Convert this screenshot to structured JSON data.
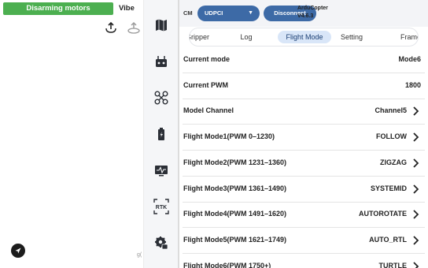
{
  "left_panel": {
    "status_text": "Disarming motors",
    "vibe_label": "Vibe",
    "edge_text": "g("
  },
  "topbar": {
    "cm_label": "CM",
    "connection_type": "UDPCI",
    "disconnect_label": "Disconnect",
    "firmware_name": "ArduCopter",
    "firmware_version": "V4.6.3"
  },
  "tabs": [
    {
      "label": "Gripper",
      "active": false
    },
    {
      "label": "Log",
      "active": false
    },
    {
      "label": "Flight Mode",
      "active": true
    },
    {
      "label": "Setting",
      "active": false
    },
    {
      "label": "Frame",
      "active": false
    }
  ],
  "rows": [
    {
      "label": "Current mode",
      "value": "Mode6",
      "chevron": false
    },
    {
      "label": "Current PWM",
      "value": "1800",
      "chevron": false
    },
    {
      "label": "Model Channel",
      "value": "Channel5",
      "chevron": true
    },
    {
      "label": "Flight Mode1(PWM 0–1230)",
      "value": "FOLLOW",
      "chevron": true
    },
    {
      "label": "Flight Mode2(PWM 1231–1360)",
      "value": "ZIGZAG",
      "chevron": true
    },
    {
      "label": "Flight Mode3(PWM 1361–1490)",
      "value": "SYSTEMID",
      "chevron": true
    },
    {
      "label": "Flight Mode4(PWM 1491–1620)",
      "value": "AUTOROTATE",
      "chevron": true
    },
    {
      "label": "Flight Mode5(PWM 1621–1749)",
      "value": "AUTO_RTL",
      "chevron": true
    },
    {
      "label": "Flight Mode6(PWM 1750+)",
      "value": "TURTLE",
      "chevron": true
    }
  ],
  "rail_icons": [
    "map-icon",
    "remote-controller-icon",
    "drone-icon",
    "battery-icon",
    "telemetry-icon",
    "rtk-icon",
    "settings-icon"
  ],
  "rail_rtk_text": "RTK",
  "colors": {
    "status_green": "#4caf50",
    "button_blue": "#3d6aa6",
    "tab_active_bg": "#d9e6f8"
  }
}
